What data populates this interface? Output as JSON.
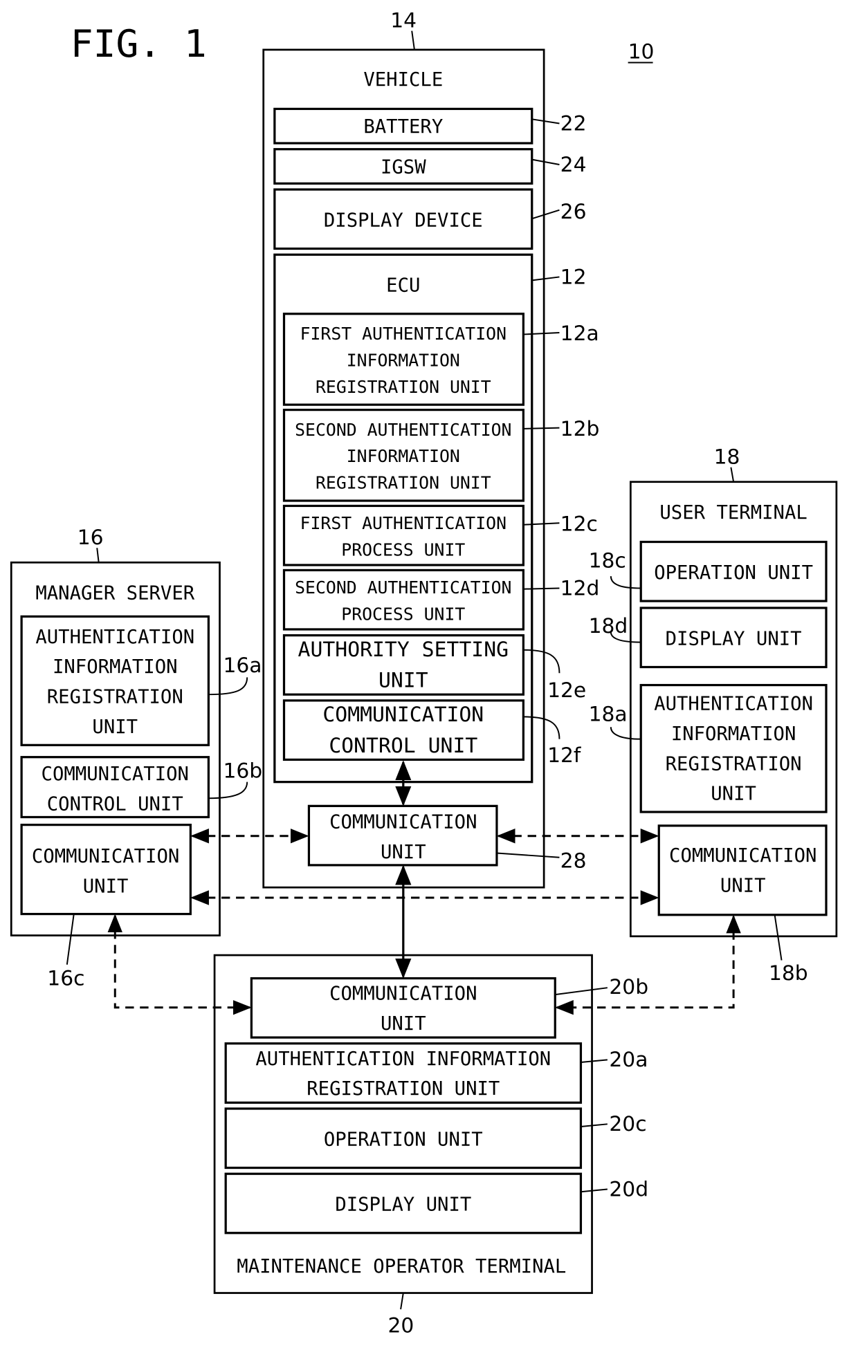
{
  "figure": {
    "title": "FIG. 1",
    "system_ref": "10"
  },
  "vehicle": {
    "ref": "14",
    "title": "VEHICLE",
    "battery": {
      "label": "BATTERY",
      "ref": "22"
    },
    "igsw": {
      "label": "IGSW",
      "ref": "24"
    },
    "display_device": {
      "label": "DISPLAY DEVICE",
      "ref": "26"
    },
    "ecu": {
      "ref": "12",
      "title": "ECU",
      "units": [
        {
          "lines": [
            "FIRST AUTHENTICATION",
            "INFORMATION",
            "REGISTRATION UNIT"
          ],
          "ref": "12a"
        },
        {
          "lines": [
            "SECOND AUTHENTICATION",
            "INFORMATION",
            "REGISTRATION UNIT"
          ],
          "ref": "12b"
        },
        {
          "lines": [
            "FIRST AUTHENTICATION",
            "PROCESS UNIT"
          ],
          "ref": "12c"
        },
        {
          "lines": [
            "SECOND AUTHENTICATION",
            "PROCESS UNIT"
          ],
          "ref": "12d"
        },
        {
          "lines": [
            "AUTHORITY SETTING",
            "UNIT"
          ],
          "ref": "12e"
        },
        {
          "lines": [
            "COMMUNICATION",
            "CONTROL UNIT"
          ],
          "ref": "12f"
        }
      ]
    },
    "comm_unit": {
      "lines": [
        "COMMUNICATION",
        "UNIT"
      ],
      "ref": "28"
    }
  },
  "manager_server": {
    "ref": "16",
    "title": "MANAGER SERVER",
    "auth_unit": {
      "lines": [
        "AUTHENTICATION",
        "INFORMATION",
        "REGISTRATION",
        "UNIT"
      ],
      "ref": "16a"
    },
    "comm_control": {
      "lines": [
        "COMMUNICATION",
        "CONTROL UNIT"
      ],
      "ref": "16b"
    },
    "comm_unit": {
      "lines": [
        "COMMUNICATION",
        "UNIT"
      ],
      "ref": "16c"
    }
  },
  "user_terminal": {
    "ref": "18",
    "title": "USER TERMINAL",
    "operation_unit": {
      "label": "OPERATION UNIT",
      "ref": "18c"
    },
    "display_unit": {
      "label": "DISPLAY UNIT",
      "ref": "18d"
    },
    "auth_unit": {
      "lines": [
        "AUTHENTICATION",
        "INFORMATION",
        "REGISTRATION",
        "UNIT"
      ],
      "ref": "18a"
    },
    "comm_unit": {
      "lines": [
        "COMMUNICATION",
        "UNIT"
      ],
      "ref": "18b"
    }
  },
  "maintenance_terminal": {
    "ref": "20",
    "title": "MAINTENANCE OPERATOR TERMINAL",
    "comm_unit": {
      "lines": [
        "COMMUNICATION",
        "UNIT"
      ],
      "ref": "20b"
    },
    "auth_unit": {
      "lines": [
        "AUTHENTICATION INFORMATION",
        "REGISTRATION UNIT"
      ],
      "ref": "20a"
    },
    "operation_unit": {
      "label": "OPERATION UNIT",
      "ref": "20c"
    },
    "display_unit": {
      "label": "DISPLAY UNIT",
      "ref": "20d"
    }
  }
}
